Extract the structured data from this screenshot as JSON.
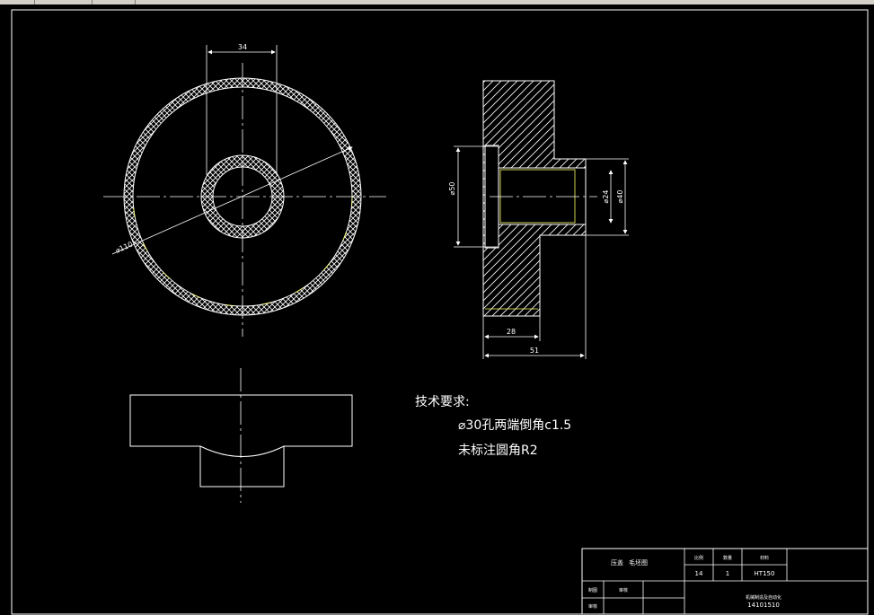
{
  "dimensions": {
    "width_34": "34",
    "dia_110": "⌀110",
    "dia_50": "⌀50",
    "dia_24": "⌀24",
    "dia_40": "⌀40",
    "len_28": "28",
    "len_51": "51"
  },
  "notes": {
    "heading": "技术要求:",
    "line1": "⌀30孔两端倒角c1.5",
    "line2": "未标注圆角R2"
  },
  "title_block": {
    "part_name": "压盖",
    "drawing_type": "毛坯图",
    "scale_label": "比例",
    "qty_label": "数量",
    "material_label": "材料",
    "scale_value": "14",
    "qty_value": "1",
    "material_value": "HT150",
    "drawn_by_label": "制图",
    "checked_by_label": "审核",
    "reviewer_label": "审核",
    "school": "机械制造及自动化",
    "drawing_number": "14101510"
  },
  "colors": {
    "background": "#000000",
    "lines": "#ffffff",
    "hatch_accent": "#ffff66"
  }
}
